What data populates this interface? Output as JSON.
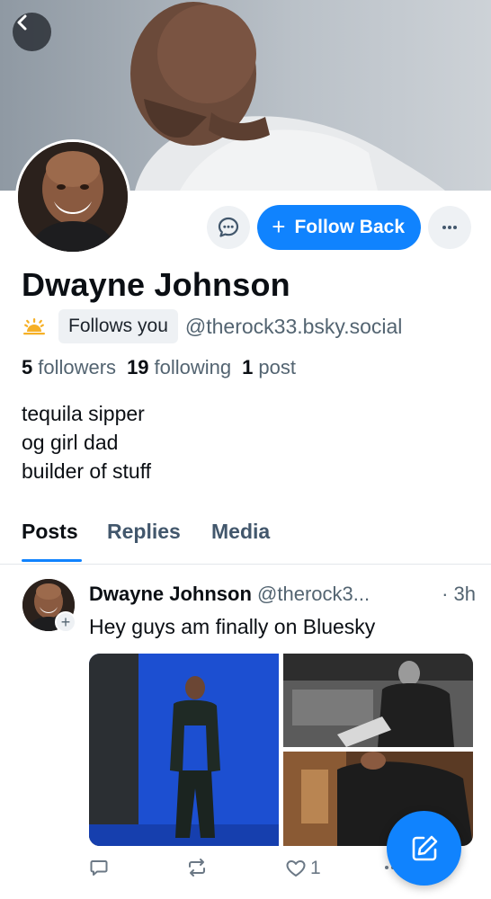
{
  "nav": {
    "back_icon": "chevron-left-icon"
  },
  "profile": {
    "name": "Dwayne Johnson",
    "follows_you_label": "Follows you",
    "handle": "@therock33.bsky.social",
    "new_account_icon": "sun-icon",
    "stats": {
      "followers_count": "5",
      "followers_label": "followers",
      "following_count": "19",
      "following_label": "following",
      "posts_count": "1",
      "posts_label": "post"
    },
    "bio": [
      "tequila sipper",
      "og girl dad",
      "builder of stuff"
    ]
  },
  "actions": {
    "message_icon": "chat-bubble-icon",
    "follow_back_label": "Follow Back",
    "more_icon": "ellipsis-icon"
  },
  "tabs": [
    {
      "label": "Posts",
      "active": true
    },
    {
      "label": "Replies",
      "active": false
    },
    {
      "label": "Media",
      "active": false
    }
  ],
  "post": {
    "author_name": "Dwayne Johnson",
    "author_handle": "@therock3...",
    "time": "· 3h",
    "text": "Hey guys am finally on Bluesky",
    "like_count": "1",
    "reply_icon": "reply-icon",
    "repost_icon": "repost-icon",
    "like_icon": "heart-icon",
    "more_icon": "ellipsis-icon"
  },
  "fab": {
    "icon": "compose-icon"
  },
  "colors": {
    "accent": "#1083fe",
    "muted": "#536471",
    "badge_bg": "#eef1f4"
  }
}
